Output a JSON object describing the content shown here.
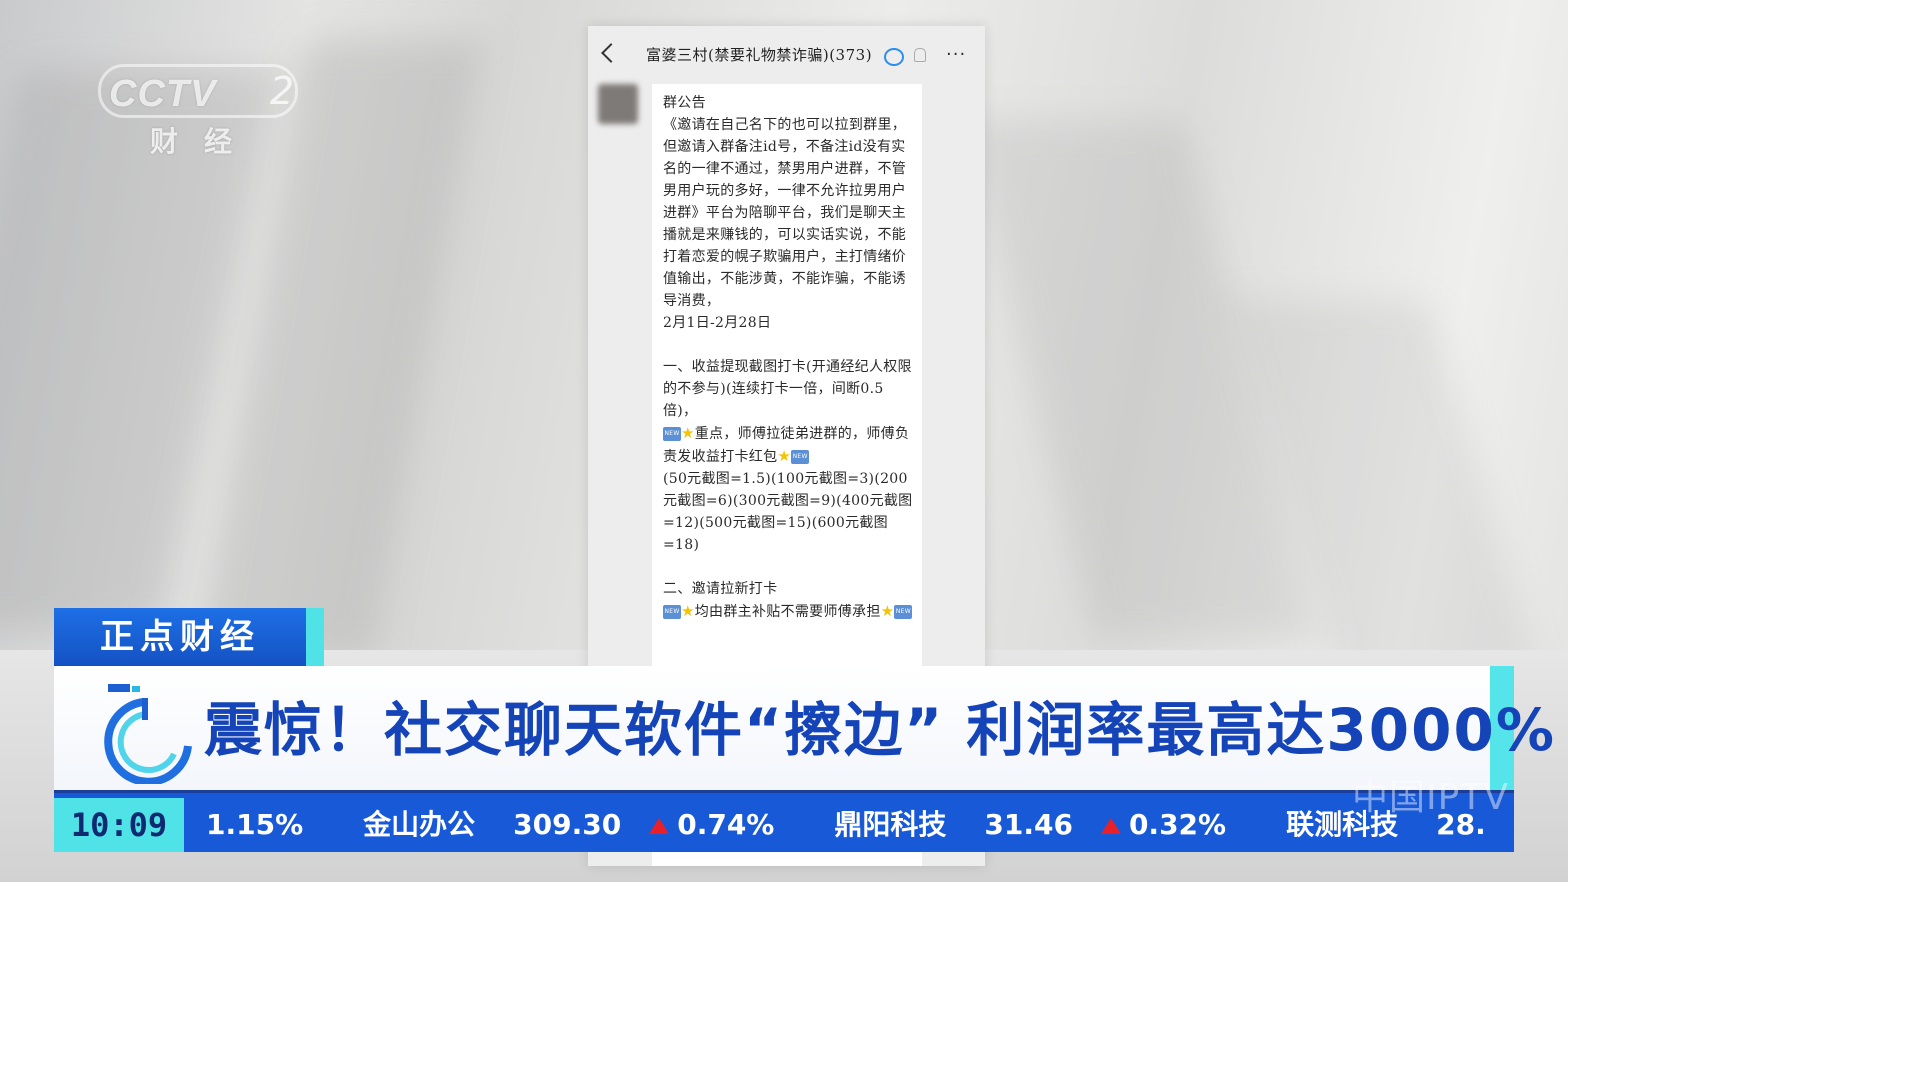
{
  "channel": {
    "logo_text": "CCTV",
    "logo_number": "2",
    "logo_sub": "财经"
  },
  "chat": {
    "title": "富婆三村(禁要礼物禁诈骗)(373)",
    "bubble_lines": [
      "群公告",
      "《邀请在自己名下的也可以拉到群里，但邀请入群备注id号，不备注id没有实名的一律不通过，禁男用户进群，不管男用户玩的多好，一律不允许拉男用户进群》平台为陪聊平台，我们是聊天主播就是来赚钱的，可以实话实说，不能打着恋爱的幌子欺骗用户，主打情绪价值输出，不能涉黄，不能诈骗，不能诱导消费，",
      "2月1日-2月28日"
    ],
    "section1_title": "一、收益提现截图打卡(开通经纪人权限的不参与)(连续打卡一倍，间断0.5倍)，",
    "section1_note": "重点，师傅拉徒弟进群的，师傅负责发收益打卡红包",
    "section1_rates": "(50元截图=1.5)(100元截图=3)(200元截图=6)(300元截图=9)(400元截图=12)(500元截图=15)(600元截图=18)",
    "section2_title": "二、邀请拉新打卡",
    "section2_note": "均由群主补贴不需要师傅承担",
    "new_label": "NEW"
  },
  "lower_third": {
    "program": "正点财经",
    "headline": "震惊！社交聊天软件“擦边” 利润率最高达3000%",
    "clock": "10:09"
  },
  "ticker": {
    "items": [
      {
        "text": "1.15%"
      },
      {
        "text": "金山办公"
      },
      {
        "text": "309.30"
      },
      {
        "text": "0.74%",
        "up": true
      },
      {
        "text": "鼎阳科技"
      },
      {
        "text": "31.46"
      },
      {
        "text": "0.32%",
        "up": true
      },
      {
        "text": "联测科技"
      },
      {
        "text": "28."
      }
    ]
  },
  "watermark": "中国IPTV",
  "colors": {
    "headline_blue": "#1444b8",
    "ticker_blue": "#1859d8",
    "accent_cyan": "#4fe3e8",
    "up_red": "#e8202a"
  }
}
